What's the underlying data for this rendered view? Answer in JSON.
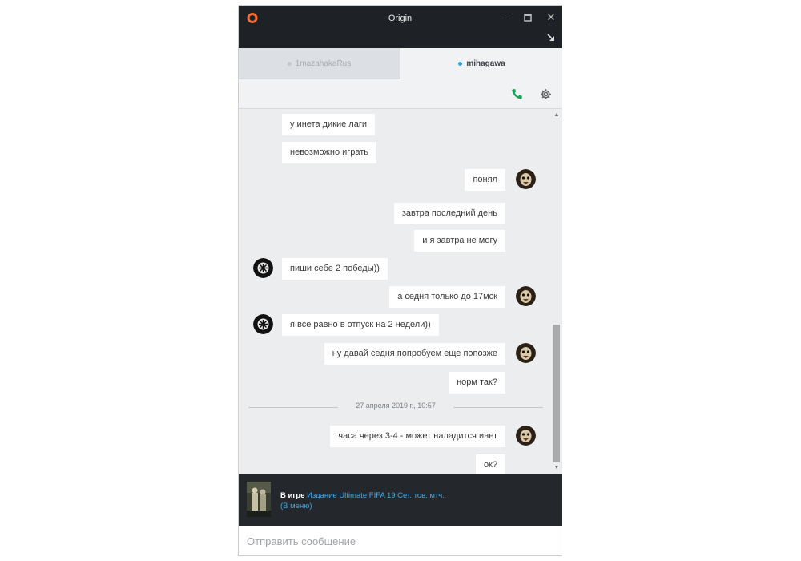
{
  "window": {
    "title": "Origin"
  },
  "tabs": [
    {
      "label": "1mazahakaRus",
      "active": false
    },
    {
      "label": "mihagawa",
      "active": true
    }
  ],
  "actions": {
    "call_icon": "phone-icon",
    "settings_icon": "gear-icon"
  },
  "messages": [
    {
      "side": "in",
      "text": "у инета дикие лаги"
    },
    {
      "side": "in",
      "text": "невозможно играть"
    },
    {
      "side": "out",
      "text": "понял"
    },
    {
      "side": "out",
      "text": "завтра последний день"
    },
    {
      "side": "out",
      "text": "и я завтра не могу"
    },
    {
      "side": "in",
      "text": "пиши себе 2 победы))"
    },
    {
      "side": "out",
      "text": "а седня только до 17мск"
    },
    {
      "side": "in",
      "text": "я все равно в отпуск на 2 недели))"
    },
    {
      "side": "out",
      "text": "ну давай седня попробуем еще попозже"
    },
    {
      "side": "out",
      "text": "норм так?"
    },
    {
      "side": "out",
      "text": "часа через 3-4 - может наладится инет"
    },
    {
      "side": "out",
      "text": "ок?"
    }
  ],
  "date_separator": "27 апреля 2019 г., 10:57",
  "ingame": {
    "prefix": "В игре",
    "game": "Издание Ultimate FIFA 19 Сет. тов. мтч. (В меню)"
  },
  "composer": {
    "placeholder": "Отправить сообщение"
  },
  "colors": {
    "titlebar": "#1e2126",
    "accent_orange": "#f56c2d",
    "call_green": "#1aa35a",
    "link_blue": "#4aa8df",
    "online_dot": "#29a8e0"
  }
}
